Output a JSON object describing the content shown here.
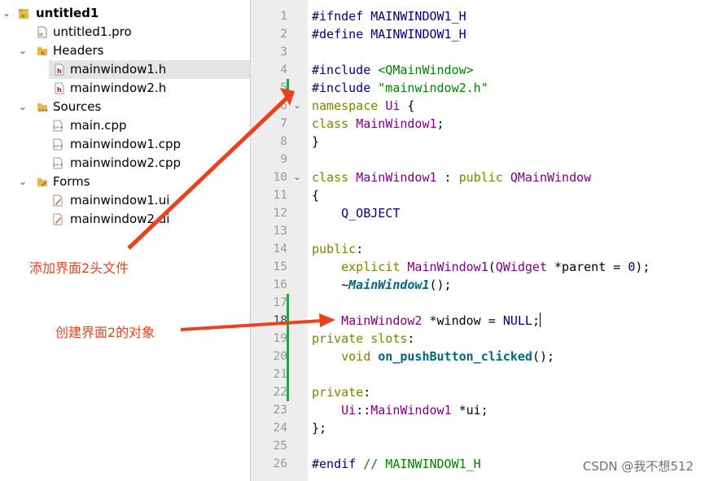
{
  "tree": {
    "project": "untitled1",
    "pro_file": "untitled1.pro",
    "headers_label": "Headers",
    "headers": [
      "mainwindow1.h",
      "mainwindow2.h"
    ],
    "sources_label": "Sources",
    "sources": [
      "main.cpp",
      "mainwindow1.cpp",
      "mainwindow2.cpp"
    ],
    "forms_label": "Forms",
    "forms": [
      "mainwindow1.ui",
      "mainwindow2.ui"
    ]
  },
  "editor": {
    "line_numbers": [
      "1",
      "2",
      "3",
      "4",
      "5",
      "6",
      "7",
      "8",
      "9",
      "10",
      "11",
      "12",
      "13",
      "14",
      "15",
      "16",
      "17",
      "18",
      "19",
      "20",
      "21",
      "22",
      "23",
      "24",
      "25",
      "26"
    ]
  },
  "annotations": {
    "add_header": "添加界面2头文件",
    "create_object": "创建界面2的对象"
  },
  "watermark": "CSDN @我不想512",
  "colors": {
    "annotation": "#e8431e",
    "accent": "#2ea043"
  }
}
